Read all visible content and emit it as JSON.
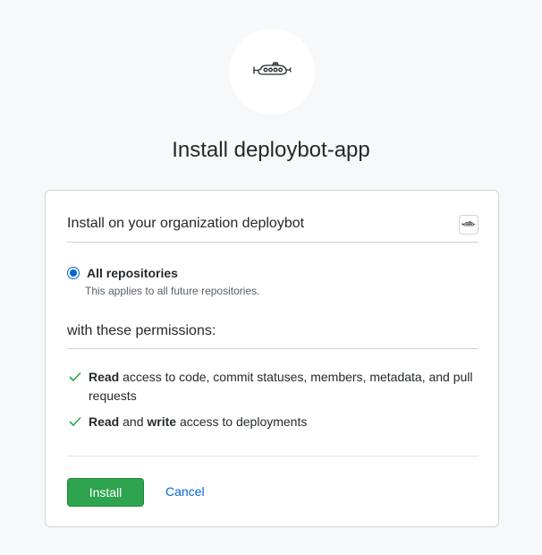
{
  "header": {
    "logo_icon": "submarine-logo-icon",
    "title": "Install deploybot-app"
  },
  "install_target": {
    "label": "Install on your organization deploybot",
    "avatar_icon": "submarine-avatar-icon"
  },
  "repositories": {
    "selected": true,
    "label": "All repositories",
    "note": "This applies to all future repositories."
  },
  "permissions": {
    "heading": "with these permissions:",
    "items": [
      {
        "parts": [
          {
            "text": "Read",
            "bold": true
          },
          {
            "text": " access to code, commit statuses, members, metadata, and pull requests",
            "bold": false
          }
        ]
      },
      {
        "parts": [
          {
            "text": "Read",
            "bold": true
          },
          {
            "text": " and ",
            "bold": false
          },
          {
            "text": "write",
            "bold": true
          },
          {
            "text": " access to deployments",
            "bold": false
          }
        ]
      }
    ],
    "check_icon": "check-icon"
  },
  "actions": {
    "install_label": "Install",
    "cancel_label": "Cancel"
  },
  "colors": {
    "background": "#f6f8fa",
    "primary_button": "#2ea44f",
    "link": "#0366d6",
    "check": "#28a745",
    "border": "#d1d5da"
  }
}
